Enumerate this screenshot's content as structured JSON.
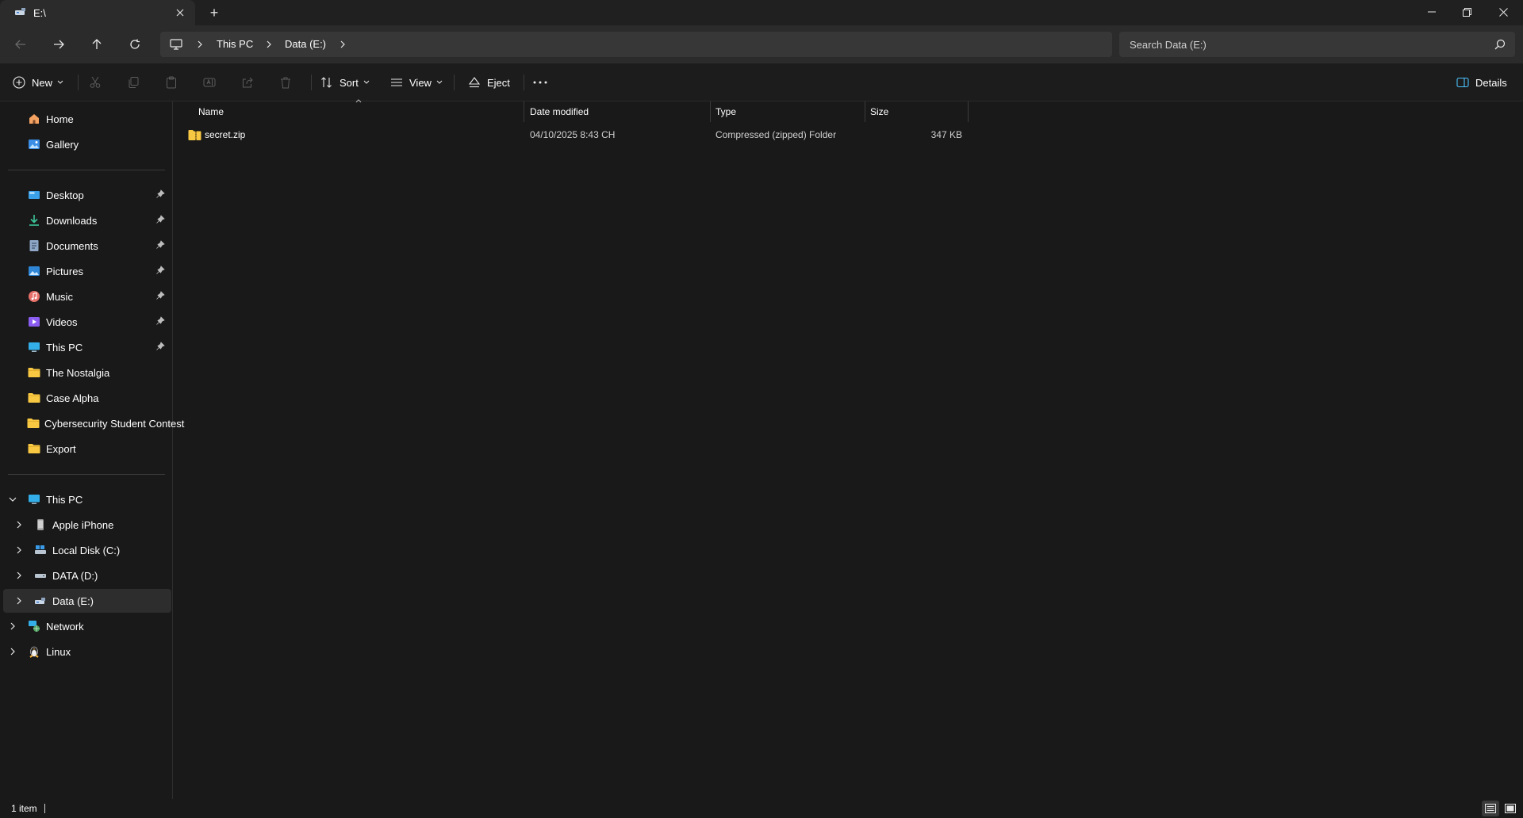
{
  "window": {
    "tab_title": "E:\\",
    "new_tab_symbol": "+"
  },
  "address": {
    "crumbs": [
      "This PC",
      "Data (E:)"
    ],
    "search_placeholder": "Search Data (E:)"
  },
  "toolbar": {
    "new_label": "New",
    "sort_label": "Sort",
    "view_label": "View",
    "eject_label": "Eject",
    "details_label": "Details"
  },
  "sidebar": {
    "top": [
      {
        "label": "Home",
        "icon": "home-icon"
      },
      {
        "label": "Gallery",
        "icon": "gallery-icon"
      }
    ],
    "quick": [
      {
        "label": "Desktop",
        "icon": "desktop-icon",
        "pinned": true
      },
      {
        "label": "Downloads",
        "icon": "downloads-icon",
        "pinned": true
      },
      {
        "label": "Documents",
        "icon": "documents-icon",
        "pinned": true
      },
      {
        "label": "Pictures",
        "icon": "pictures-icon",
        "pinned": true
      },
      {
        "label": "Music",
        "icon": "music-icon",
        "pinned": true
      },
      {
        "label": "Videos",
        "icon": "videos-icon",
        "pinned": true
      },
      {
        "label": "This PC",
        "icon": "this-pc-icon",
        "pinned": true
      },
      {
        "label": "The Nostalgia",
        "icon": "folder-icon",
        "pinned": false
      },
      {
        "label": "Case Alpha",
        "icon": "folder-icon",
        "pinned": false
      },
      {
        "label": "Cybersecurity Student Contest",
        "icon": "folder-icon",
        "pinned": false
      },
      {
        "label": "Export",
        "icon": "folder-icon",
        "pinned": false
      }
    ],
    "tree": [
      {
        "label": "This PC",
        "icon": "this-pc-icon",
        "expanded": true
      },
      {
        "label": "Apple iPhone",
        "icon": "phone-icon"
      },
      {
        "label": "Local Disk (C:)",
        "icon": "system-drive-icon"
      },
      {
        "label": "DATA (D:)",
        "icon": "drive-icon"
      },
      {
        "label": "Data (E:)",
        "icon": "usb-drive-icon",
        "selected": true
      },
      {
        "label": "Network",
        "icon": "network-icon"
      },
      {
        "label": "Linux",
        "icon": "linux-icon"
      }
    ]
  },
  "columns": [
    "Name",
    "Date modified",
    "Type",
    "Size"
  ],
  "files": [
    {
      "name": "secret.zip",
      "date_modified": "04/10/2025 8:43 CH",
      "type": "Compressed (zipped) Folder",
      "size": "347 KB"
    }
  ],
  "status": {
    "item_count": "1 item"
  },
  "colors": {
    "background": "#191919",
    "folder": "#F8C842",
    "accent": "#4CC2FF"
  }
}
